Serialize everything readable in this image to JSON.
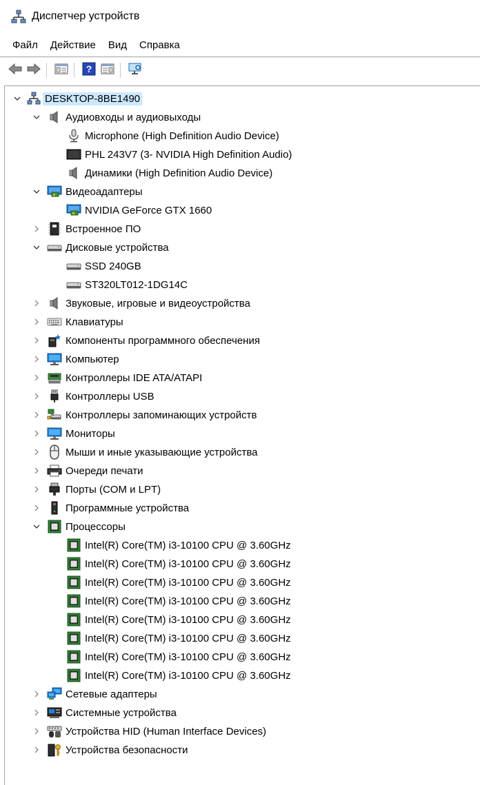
{
  "window": {
    "title": "Диспетчер устройств"
  },
  "menu": [
    {
      "key": "file",
      "label": "Файл"
    },
    {
      "key": "action",
      "label": "Действие"
    },
    {
      "key": "view",
      "label": "Вид"
    },
    {
      "key": "help",
      "label": "Справка"
    }
  ],
  "toolbar": [
    {
      "key": "back",
      "icon": "back-arrow-icon"
    },
    {
      "key": "forward",
      "icon": "forward-arrow-icon"
    },
    {
      "sep": true
    },
    {
      "key": "show-hide-console-tree",
      "icon": "console-tree-icon"
    },
    {
      "sep": true
    },
    {
      "key": "help",
      "icon": "help-icon"
    },
    {
      "key": "properties-pane",
      "icon": "action-pane-icon"
    },
    {
      "sep": true
    },
    {
      "key": "scan-hardware",
      "icon": "monitor-scan-icon"
    }
  ],
  "tree": [
    {
      "level": 0,
      "expanded": true,
      "selected": true,
      "icon": "computer-network-icon",
      "label": "DESKTOP-8BE1490"
    },
    {
      "level": 1,
      "expanded": true,
      "icon": "speaker-icon",
      "label": "Аудиовходы и аудиовыходы"
    },
    {
      "level": 2,
      "icon": "microphone-icon",
      "label": "Microphone (High Definition Audio Device)"
    },
    {
      "level": 2,
      "icon": "display-black-icon",
      "label": "PHL 243V7 (3- NVIDIA High Definition Audio)"
    },
    {
      "level": 2,
      "icon": "speaker-icon",
      "label": "Динамики (High Definition Audio Device)"
    },
    {
      "level": 1,
      "expanded": true,
      "icon": "display-adapter-icon",
      "label": "Видеоадаптеры"
    },
    {
      "level": 2,
      "icon": "display-adapter-icon",
      "label": "NVIDIA GeForce GTX 1660"
    },
    {
      "level": 1,
      "expanded": false,
      "icon": "firmware-icon",
      "label": "Встроенное ПО"
    },
    {
      "level": 1,
      "expanded": true,
      "icon": "disk-drive-icon",
      "label": "Дисковые устройства"
    },
    {
      "level": 2,
      "icon": "disk-drive-icon",
      "label": "SSD 240GB"
    },
    {
      "level": 2,
      "icon": "disk-drive-icon",
      "label": "ST320LT012-1DG14C"
    },
    {
      "level": 1,
      "expanded": false,
      "icon": "speaker-icon",
      "label": "Звуковые, игровые и видеоустройства"
    },
    {
      "level": 1,
      "expanded": false,
      "icon": "keyboard-icon",
      "label": "Клавиатуры"
    },
    {
      "level": 1,
      "expanded": false,
      "icon": "software-component-icon",
      "label": "Компоненты программного обеспечения"
    },
    {
      "level": 1,
      "expanded": false,
      "icon": "monitor-icon",
      "label": "Компьютер"
    },
    {
      "level": 1,
      "expanded": false,
      "icon": "ide-controller-icon",
      "label": "Контроллеры IDE ATA/ATAPI"
    },
    {
      "level": 1,
      "expanded": false,
      "icon": "usb-icon",
      "label": "Контроллеры USB"
    },
    {
      "level": 1,
      "expanded": false,
      "icon": "storage-controller-icon",
      "label": "Контроллеры запоминающих устройств"
    },
    {
      "level": 1,
      "expanded": false,
      "icon": "monitor-icon",
      "label": "Мониторы"
    },
    {
      "level": 1,
      "expanded": false,
      "icon": "mouse-icon",
      "label": "Мыши и иные указывающие устройства"
    },
    {
      "level": 1,
      "expanded": false,
      "icon": "printer-icon",
      "label": "Очереди печати"
    },
    {
      "level": 1,
      "expanded": false,
      "icon": "port-icon",
      "label": "Порты (COM и LPT)"
    },
    {
      "level": 1,
      "expanded": false,
      "icon": "software-device-icon",
      "label": "Программные устройства"
    },
    {
      "level": 1,
      "expanded": true,
      "icon": "processor-icon",
      "label": "Процессоры"
    },
    {
      "level": 2,
      "icon": "processor-icon",
      "label": "Intel(R) Core(TM) i3-10100 CPU @ 3.60GHz"
    },
    {
      "level": 2,
      "icon": "processor-icon",
      "label": "Intel(R) Core(TM) i3-10100 CPU @ 3.60GHz"
    },
    {
      "level": 2,
      "icon": "processor-icon",
      "label": "Intel(R) Core(TM) i3-10100 CPU @ 3.60GHz"
    },
    {
      "level": 2,
      "icon": "processor-icon",
      "label": "Intel(R) Core(TM) i3-10100 CPU @ 3.60GHz"
    },
    {
      "level": 2,
      "icon": "processor-icon",
      "label": "Intel(R) Core(TM) i3-10100 CPU @ 3.60GHz"
    },
    {
      "level": 2,
      "icon": "processor-icon",
      "label": "Intel(R) Core(TM) i3-10100 CPU @ 3.60GHz"
    },
    {
      "level": 2,
      "icon": "processor-icon",
      "label": "Intel(R) Core(TM) i3-10100 CPU @ 3.60GHz"
    },
    {
      "level": 2,
      "icon": "processor-icon",
      "label": "Intel(R) Core(TM) i3-10100 CPU @ 3.60GHz"
    },
    {
      "level": 1,
      "expanded": false,
      "icon": "network-adapter-icon",
      "label": "Сетевые адаптеры"
    },
    {
      "level": 1,
      "expanded": false,
      "icon": "system-device-icon",
      "label": "Системные устройства"
    },
    {
      "level": 1,
      "expanded": false,
      "icon": "hid-icon",
      "label": "Устройства HID (Human Interface Devices)"
    },
    {
      "level": 1,
      "expanded": false,
      "icon": "security-device-icon",
      "label": "Устройства безопасности"
    }
  ]
}
